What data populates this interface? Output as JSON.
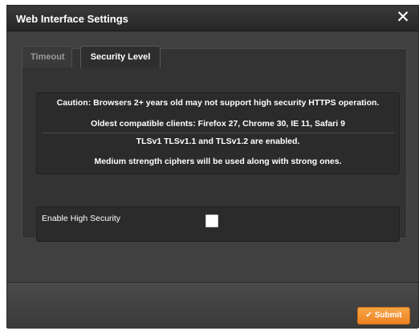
{
  "dialog": {
    "title": "Web Interface Settings",
    "close_icon": "close-icon"
  },
  "tabs": [
    {
      "label": "Timeout",
      "active": false
    },
    {
      "label": "Security Level",
      "active": true
    }
  ],
  "info": {
    "caution": "Caution: Browsers 2+ years old may not support high security HTTPS operation.",
    "clients": "Oldest compatible clients: Firefox 27, Chrome 30, IE 11, Safari 9",
    "protocols": "TLSv1 TLSv1.1 and TLSv1.2 are enabled.",
    "ciphers": "Medium strength ciphers will be used along with strong ones."
  },
  "setting": {
    "label": "Enable High Security",
    "checked": false
  },
  "footer": {
    "submit_label": "Submit",
    "submit_icon": "check-icon"
  },
  "colors": {
    "dialog_bg": "#383838",
    "panel_bg": "#2b2b2b",
    "accent": "#f19536"
  }
}
